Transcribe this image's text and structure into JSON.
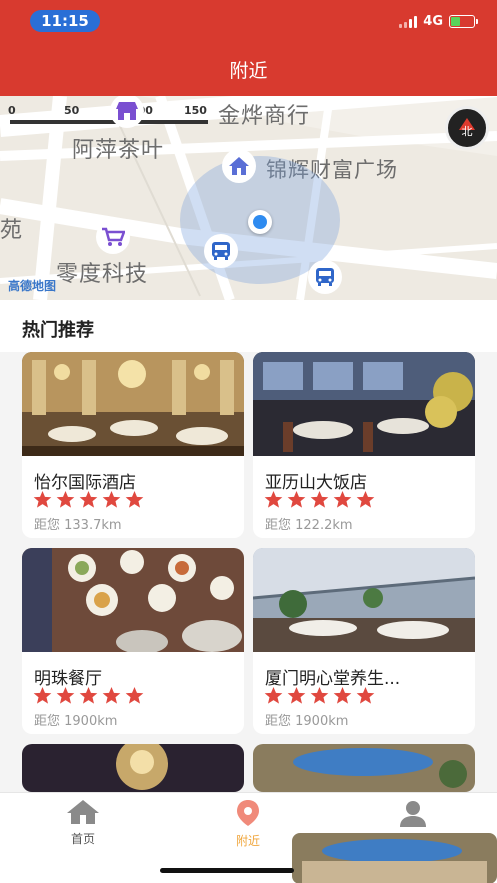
{
  "status_bar": {
    "time": "11:15",
    "network": "4G"
  },
  "header": {
    "title": "附近"
  },
  "map": {
    "scale": {
      "ticks": [
        "0",
        "50",
        "100",
        "150"
      ]
    },
    "labels": [
      {
        "text": "金烨商行"
      },
      {
        "text": "阿萍茶叶"
      },
      {
        "text": "锦辉财富广场"
      },
      {
        "text": "苑"
      },
      {
        "text": "零度科技"
      }
    ],
    "compass_label": "北",
    "provider": "高德地图",
    "poi_icons": [
      "store-icon",
      "home-icon",
      "cart-icon",
      "bus-icon",
      "bus-icon"
    ]
  },
  "section": {
    "title": "热门推荐"
  },
  "restaurants": [
    {
      "name": "怡尔国际酒店",
      "rating": 5,
      "distance": "距您 133.7km"
    },
    {
      "name": "亚历山大饭店",
      "rating": 5,
      "distance": "距您 122.2km"
    },
    {
      "name": "明珠餐厅",
      "rating": 5,
      "distance": "距您 1900km"
    },
    {
      "name": "厦门明心堂养生...",
      "rating": 5,
      "distance": "距您 1900km"
    }
  ],
  "tabbar": {
    "items": [
      {
        "label": "首页",
        "icon": "home-icon",
        "active": false
      },
      {
        "label": "附近",
        "icon": "location-pin-icon",
        "active": true
      },
      {
        "label": "",
        "icon": "user-icon",
        "active": false
      }
    ]
  },
  "colors": {
    "brand": "#d83a2f",
    "star": "#e0483f",
    "active_tab": "#f0a63c",
    "inactive_tab": "#8a8a8a"
  }
}
